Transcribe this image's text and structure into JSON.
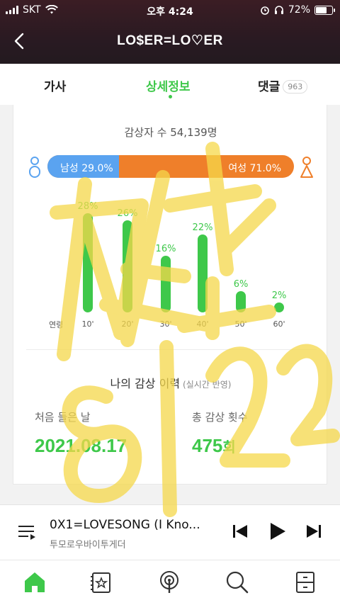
{
  "status": {
    "carrier": "SKT",
    "time": "오후 4:24",
    "battery": "72%",
    "battery_level": 0.72
  },
  "header": {
    "title": "LO$ER=LO♡ER"
  },
  "tabs": [
    {
      "label": "가사"
    },
    {
      "label": "상세정보"
    },
    {
      "label": "댓글",
      "count": "963"
    }
  ],
  "stats": {
    "listeners": "감상자 수 54,139명",
    "gender": {
      "male_label": "남성 29.0%",
      "female_label": "여성 71.0%",
      "male_share": 29.0,
      "male_color": "#5aa3f0",
      "female_color": "#ef7f2a"
    },
    "age_axis_label": "연령"
  },
  "chart_data": {
    "type": "bar",
    "categories": [
      "10'",
      "20'",
      "30'",
      "40'",
      "50'",
      "60'"
    ],
    "values": [
      28,
      26,
      16,
      22,
      6,
      2
    ],
    "value_labels": [
      "28%",
      "26%",
      "16%",
      "22%",
      "6%",
      "2%"
    ],
    "xlabel": "연령",
    "color": "#3ec84a"
  },
  "history": {
    "title": "나의 감상 이력",
    "note": "(실시간 반영)",
    "first_label": "처음 들은 날",
    "first_value": "2021.08.17",
    "total_label": "총 감상 횟수",
    "total_value": "475",
    "total_unit": "회"
  },
  "player": {
    "title": "0X1=LOVESONG (I Kno...",
    "artist": "투모로우바이투게더"
  },
  "colors": {
    "accent": "#3ec84a",
    "scribble": "#f5d84a"
  },
  "overlay_text": {
    "scribble_top": "짜란",
    "scribble_bottom": "8|22"
  },
  "icons": {
    "queue": "queue-list-icon",
    "prev": "skip-previous-icon",
    "play": "play-icon",
    "next": "skip-next-icon",
    "home": "home-icon",
    "library": "library-star-icon",
    "podcast": "podcast-icon",
    "search": "search-icon",
    "menu": "drawer-menu-icon"
  }
}
